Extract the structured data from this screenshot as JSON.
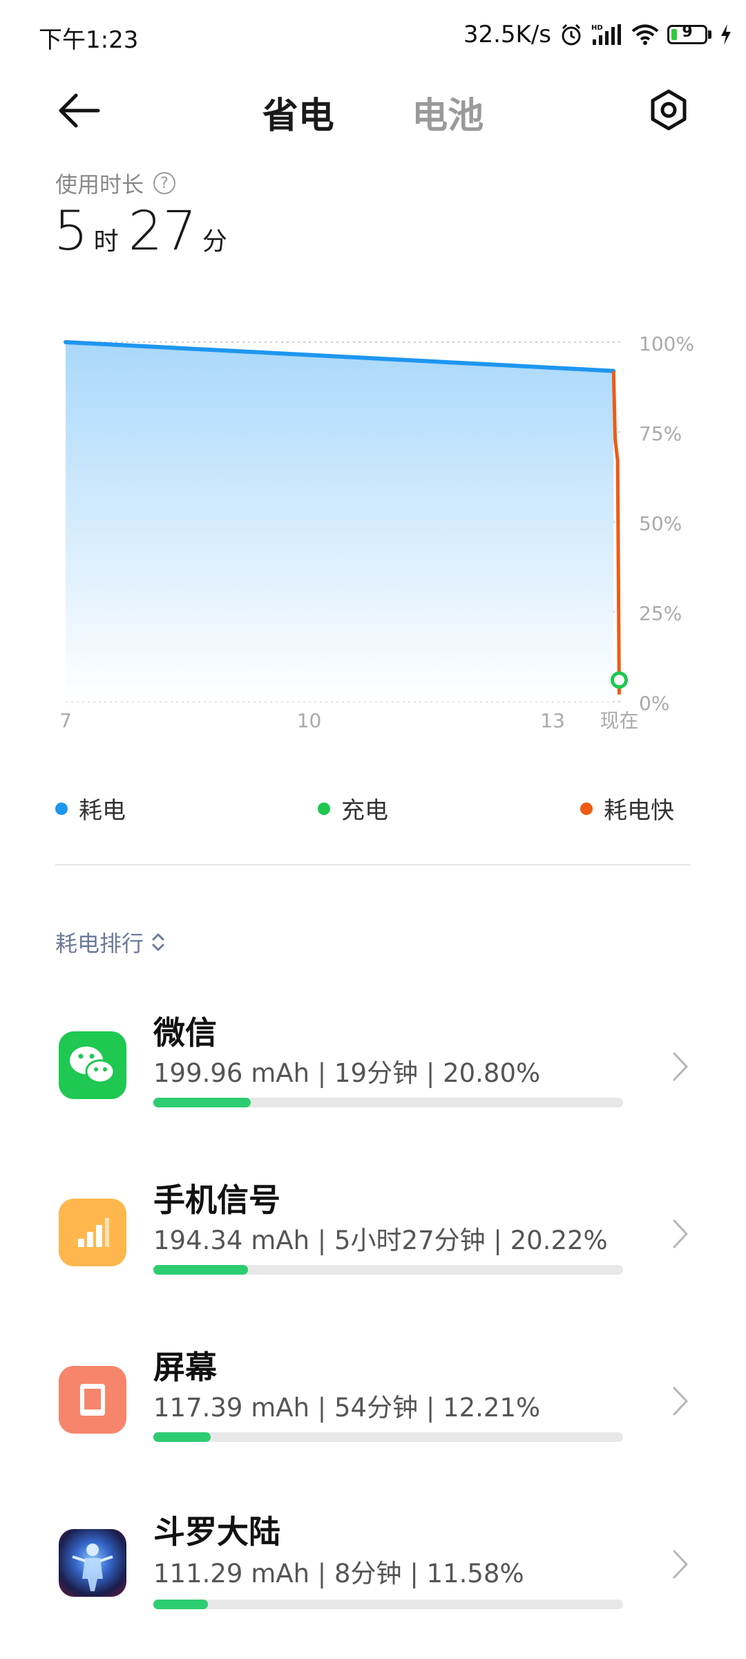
{
  "status_bar": {
    "time": "下午1:23",
    "net_speed": "32.5K/s",
    "battery_level": "9",
    "icons": [
      "alarm-icon",
      "hd-signal-icon",
      "wifi-icon",
      "battery-icon",
      "charging-icon"
    ]
  },
  "header": {
    "tabs": [
      {
        "label": "省电",
        "active": true
      },
      {
        "label": "电池",
        "active": false
      }
    ]
  },
  "usage": {
    "label": "使用时长",
    "hours": "5",
    "hours_unit": "时",
    "minutes": "27",
    "minutes_unit": "分"
  },
  "chart_data": {
    "type": "line",
    "x_tick_labels": [
      "7",
      "10",
      "13",
      "现在"
    ],
    "y_tick_labels": [
      "100%",
      "75%",
      "50%",
      "25%",
      "0%"
    ],
    "ylim": [
      0,
      100
    ],
    "series": [
      {
        "name": "耗电",
        "color": "#1e96f0",
        "x": [
          7,
          13.75
        ],
        "y": [
          100,
          92
        ]
      },
      {
        "name": "耗电快",
        "color": "#f05a14",
        "x": [
          13.75,
          13.77,
          13.8,
          13.82
        ],
        "y": [
          92,
          73,
          67,
          2
        ]
      },
      {
        "name": "充电",
        "color": "#1ec850",
        "x": [
          13.82
        ],
        "y": [
          6
        ]
      }
    ],
    "legend": [
      {
        "label": "耗电",
        "color": "#1e96f0"
      },
      {
        "label": "充电",
        "color": "#1ec850"
      },
      {
        "label": "耗电快",
        "color": "#f05a14"
      }
    ],
    "grid": true
  },
  "ranking": {
    "title": "耗电排行",
    "apps": [
      {
        "name": "微信",
        "stats": "199.96 mAh | 19分钟 | 20.80%",
        "percent": 20.8,
        "icon": "wechat-icon",
        "icon_color": "#1ec851"
      },
      {
        "name": "手机信号",
        "stats": "194.34 mAh | 5小时27分钟 | 20.22%",
        "percent": 20.22,
        "icon": "signal-icon",
        "icon_color": "#ffb74d"
      },
      {
        "name": "屏幕",
        "stats": "117.39 mAh | 54分钟 | 12.21%",
        "percent": 12.21,
        "icon": "screen-icon",
        "icon_color": "#f7856b"
      },
      {
        "name": "斗罗大陆",
        "stats": "111.29 mAh | 8分钟 | 11.58%",
        "percent": 11.58,
        "icon": "game-icon",
        "icon_color": "#2a4a9a"
      }
    ]
  },
  "colors": {
    "accent_green": "#2ecc71",
    "drain_blue": "#1e96f0",
    "fast_drain_orange": "#f05a14",
    "charge_green": "#1ec850"
  }
}
